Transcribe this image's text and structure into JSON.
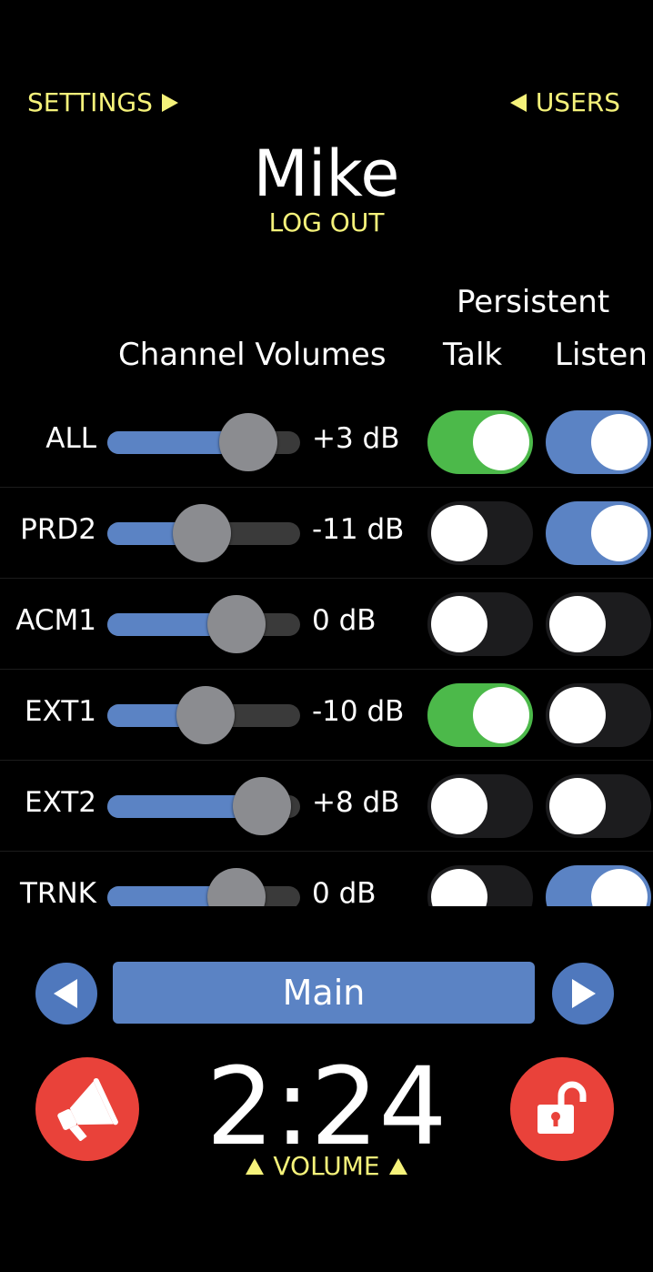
{
  "nav": {
    "settings_label": "SETTINGS",
    "users_label": "USERS"
  },
  "user": {
    "name": "Mike",
    "logout_label": "LOG OUT"
  },
  "headers": {
    "persistent": "Persistent",
    "channel_volumes": "Channel Volumes",
    "talk": "Talk",
    "listen": "Listen"
  },
  "channels": [
    {
      "name": "ALL",
      "volume_db": 3,
      "volume_label": "+3 dB",
      "level": 0.73,
      "talk": true,
      "listen": true
    },
    {
      "name": "PRD2",
      "volume_db": -11,
      "volume_label": "-11 dB",
      "level": 0.49,
      "talk": false,
      "listen": true
    },
    {
      "name": "ACM1",
      "volume_db": 0,
      "volume_label": "0 dB",
      "level": 0.67,
      "talk": false,
      "listen": false
    },
    {
      "name": "EXT1",
      "volume_db": -10,
      "volume_label": "-10 dB",
      "level": 0.51,
      "talk": true,
      "listen": false
    },
    {
      "name": "EXT2",
      "volume_db": 8,
      "volume_label": "+8 dB",
      "level": 0.8,
      "talk": false,
      "listen": false
    },
    {
      "name": "TRNK",
      "volume_db": 0,
      "volume_label": "0 dB",
      "level": 0.67,
      "talk": false,
      "listen": true
    }
  ],
  "page_selector": {
    "current": "Main"
  },
  "timer": {
    "value": "2:24"
  },
  "volume_label": "VOLUME",
  "icons": {
    "prev": "triangle-left-icon",
    "next": "triangle-right-icon",
    "announce": "megaphone-icon",
    "lock": "unlocked-padlock-icon"
  },
  "colors": {
    "accent_yellow": "#f5f27a",
    "blue": "#5b83c4",
    "green": "#4cb94a",
    "red": "#e9423a",
    "thumb_gray": "#8b8c90"
  }
}
